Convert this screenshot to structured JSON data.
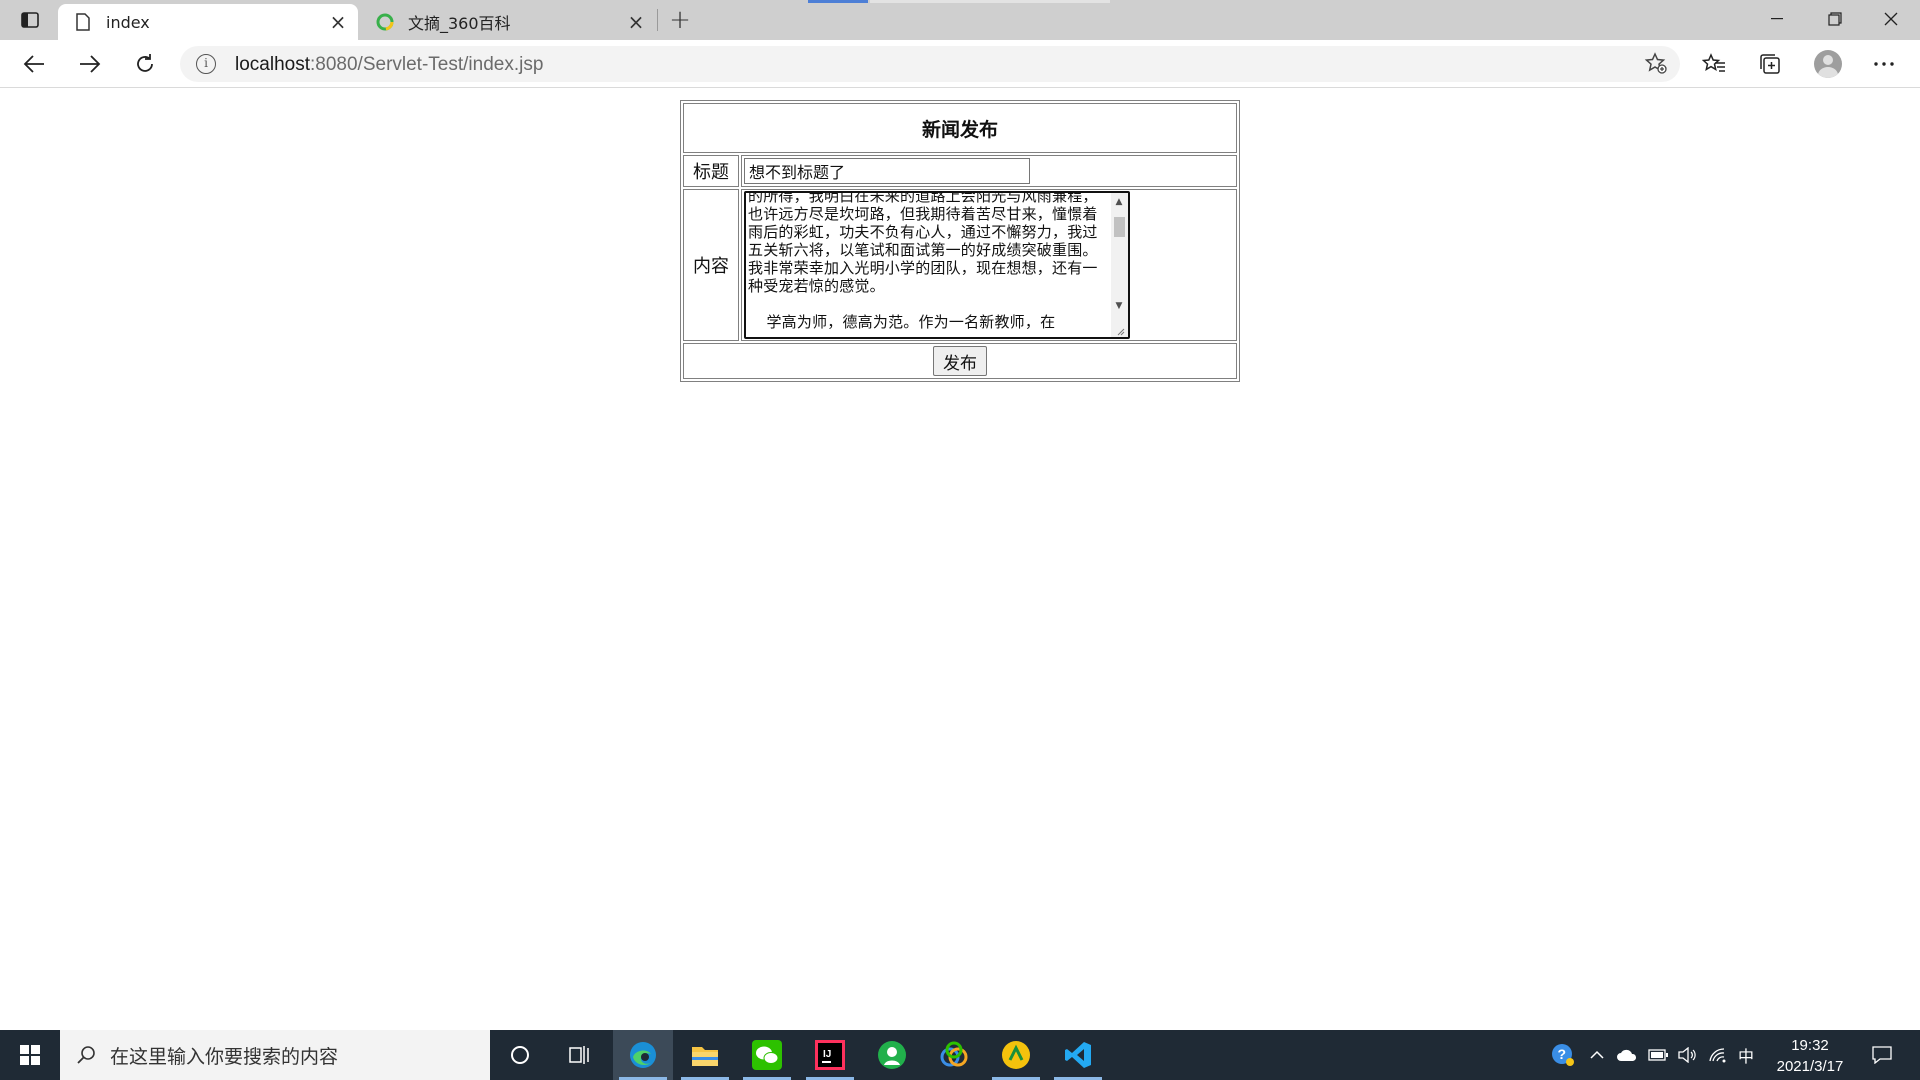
{
  "browser": {
    "tabs": [
      {
        "title": "index",
        "icon": "page-icon",
        "active": true
      },
      {
        "title": "文摘_360百科",
        "icon": "360-favicon",
        "active": false
      }
    ],
    "address": {
      "host": "localhost",
      "rest": ":8080/Servlet-Test/index.jsp"
    }
  },
  "form": {
    "heading": "新闻发布",
    "title_label": "标题",
    "title_value": "想不到标题了",
    "content_label": "内容",
    "content_value": "的所得，我明白在未来的道路上会阳光与风雨兼程，也许远方尽是坎坷路，但我期待着苦尽甘来，憧憬着雨后的彩虹，功夫不负有心人，通过不懈努力，我过五关斩六将，以笔试和面试第一的好成绩突破重围。我非常荣幸加入光明小学的团队，现在想想，还有一种受宠若惊的感觉。\n\n  学高为师，德高为范。作为一名新教师，在",
    "submit_label": "发布"
  },
  "taskbar": {
    "search_placeholder": "在这里输入你要搜索的内容",
    "ime": "中",
    "time": "19:32",
    "date": "2021/3/17",
    "apps": [
      "cortana-icon",
      "task-view-icon",
      "edge-icon",
      "file-explorer-icon",
      "wechat-icon",
      "intellij-icon",
      "green-app-icon",
      "colorful-app-icon",
      "yellow-app-icon",
      "vscode-icon"
    ]
  }
}
